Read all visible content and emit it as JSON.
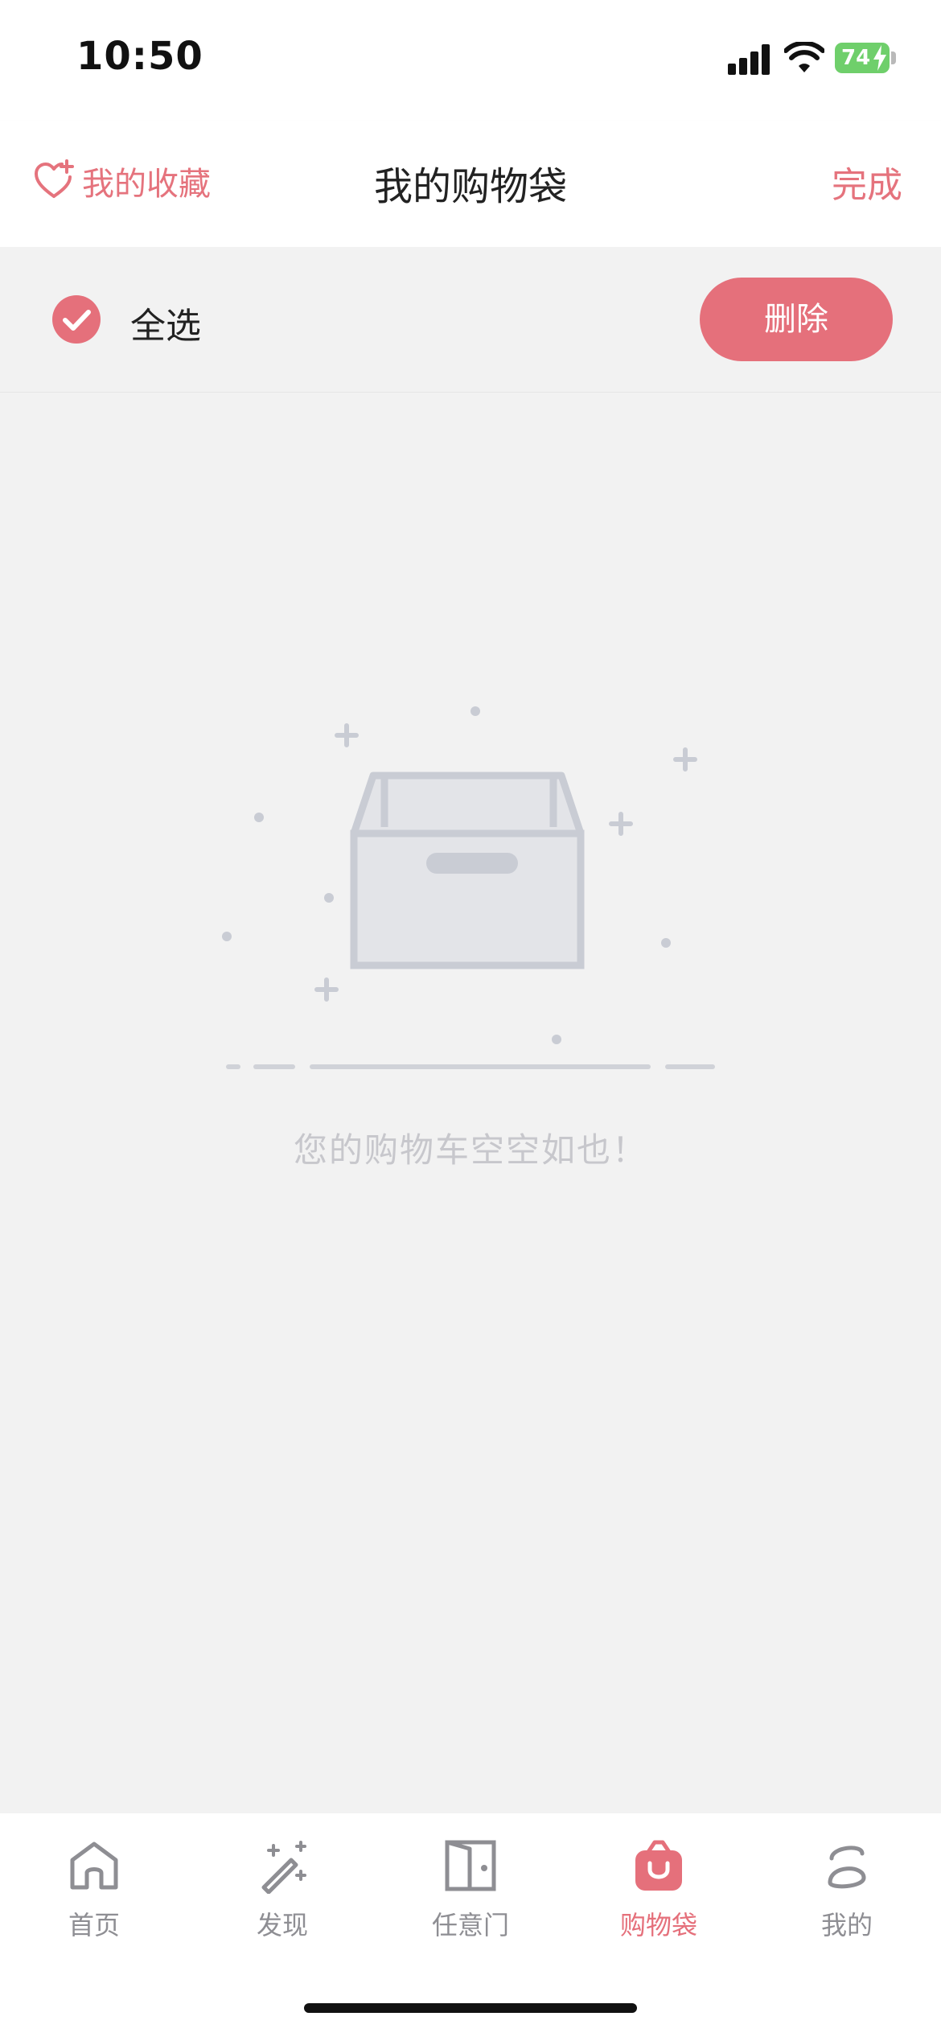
{
  "status_bar": {
    "time": "10:50",
    "battery": "74"
  },
  "nav": {
    "favorites_label": "我的收藏",
    "title": "我的购物袋",
    "done_label": "完成"
  },
  "select_bar": {
    "select_all_label": "全选",
    "delete_label": "删除"
  },
  "empty_state": {
    "message": "您的购物车空空如也！"
  },
  "tabs": [
    {
      "label": "首页",
      "icon": "home-icon",
      "active": false
    },
    {
      "label": "发现",
      "icon": "magic-wand-icon",
      "active": false
    },
    {
      "label": "任意门",
      "icon": "door-icon",
      "active": false
    },
    {
      "label": "购物袋",
      "icon": "shopping-bag-icon",
      "active": true
    },
    {
      "label": "我的",
      "icon": "profile-icon",
      "active": false
    }
  ],
  "colors": {
    "accent": "#e5707b",
    "background": "#f2f2f2",
    "muted": "#c7c7cc"
  }
}
